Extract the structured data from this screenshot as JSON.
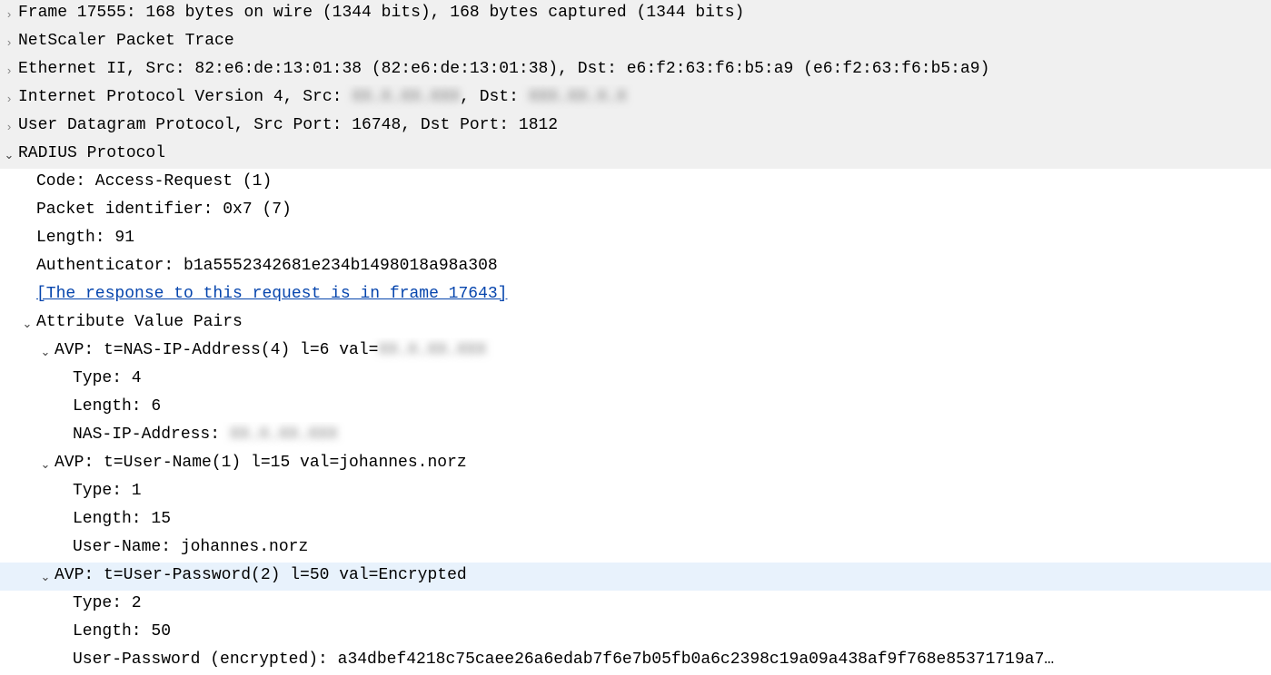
{
  "frame": {
    "summary": "Frame 17555: 168 bytes on wire (1344 bits), 168 bytes captured (1344 bits)"
  },
  "netscaler": {
    "summary": "NetScaler Packet Trace"
  },
  "ethernet": {
    "summary": "Ethernet II, Src: 82:e6:de:13:01:38 (82:e6:de:13:01:38), Dst: e6:f2:63:f6:b5:a9 (e6:f2:63:f6:b5:a9)"
  },
  "ipv4": {
    "prefix": "Internet Protocol Version 4, Src: ",
    "src_masked": "XX.X.XX.XXX",
    "mid": ", Dst: ",
    "dst_masked": "XXX.XX.X.X"
  },
  "udp": {
    "summary": "User Datagram Protocol, Src Port: 16748, Dst Port: 1812"
  },
  "radius": {
    "header": "RADIUS Protocol",
    "code": "Code: Access-Request (1)",
    "pkt_id": "Packet identifier: 0x7 (7)",
    "length": "Length: 91",
    "authenticator": "Authenticator: b1a5552342681e234b1498018a98a308",
    "response_link": "[The response to this request is in frame 17643]",
    "avp_header": "Attribute Value Pairs",
    "avps": [
      {
        "line_prefix": "AVP: t=NAS-IP-Address(4) l=6 val=",
        "line_masked": "XX.X.XX.XXX",
        "type": "Type: 4",
        "length": "Length: 6",
        "value_label": "NAS-IP-Address: ",
        "value_masked": "XX.X.XX.XXX"
      },
      {
        "line": "AVP: t=User-Name(1) l=15 val=johannes.norz",
        "type": "Type: 1",
        "length": "Length: 15",
        "value": "User-Name: johannes.norz"
      },
      {
        "line": "AVP: t=User-Password(2) l=50 val=Encrypted",
        "type": "Type: 2",
        "length": "Length: 50",
        "value": "User-Password (encrypted): a34dbef4218c75caee26a6edab7f6e7b05fb0a6c2398c19a09a438af9f768e85371719a7…"
      }
    ]
  }
}
